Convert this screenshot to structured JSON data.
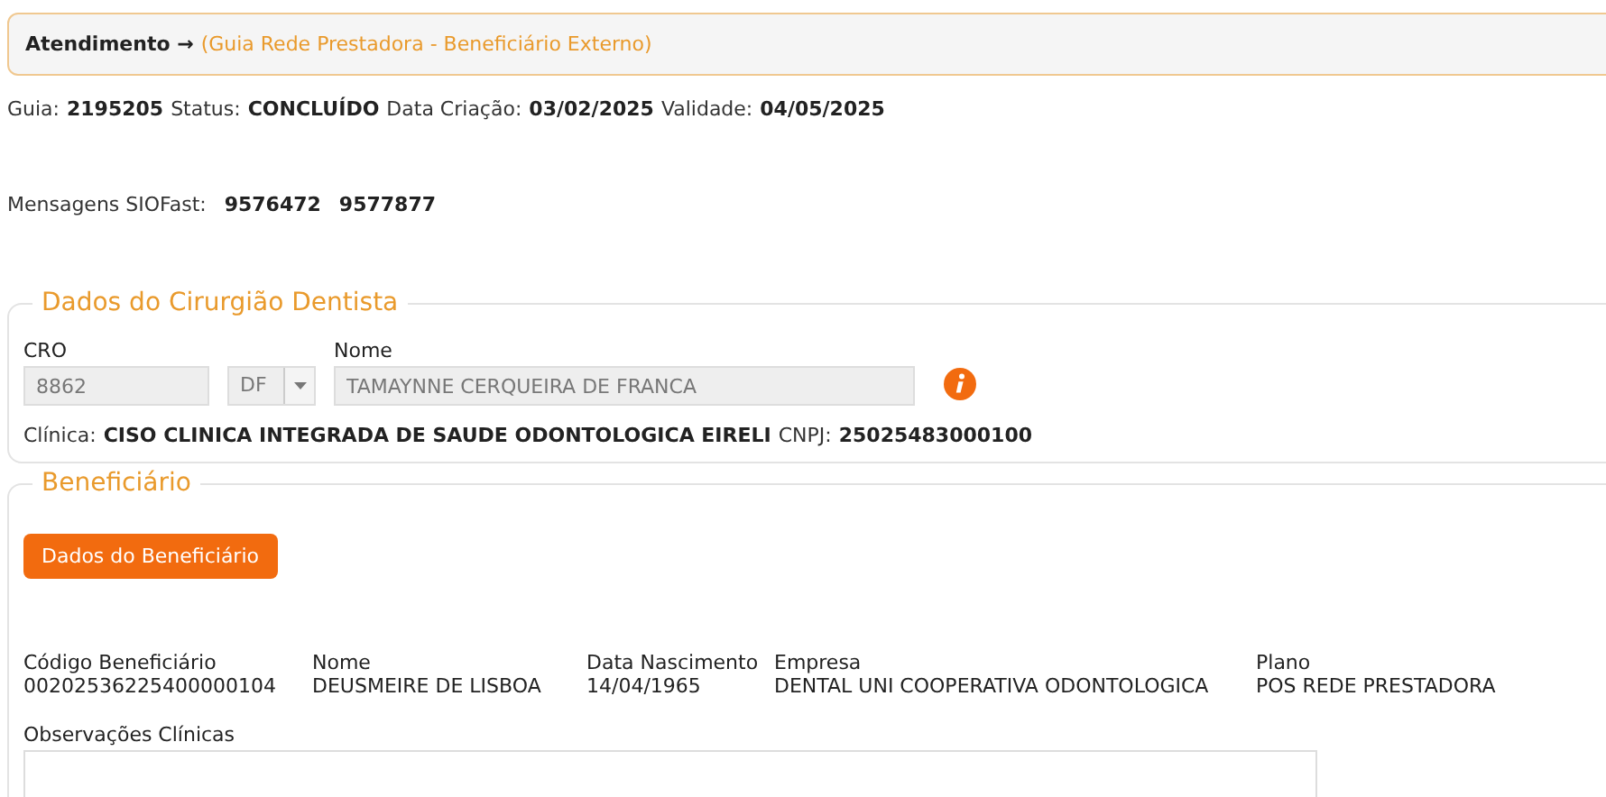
{
  "header": {
    "title": "Atendimento →",
    "subtitle": "(Guia Rede Prestadora - Beneficiário Externo)"
  },
  "guia_info": [
    {
      "label": "Guia:",
      "value": "2195205"
    },
    {
      "label": "Status:",
      "value": "CONCLUÍDO"
    },
    {
      "label": "Data Criação:",
      "value": "03/02/2025"
    },
    {
      "label": "Validade:",
      "value": "04/05/2025"
    }
  ],
  "messages": {
    "label": "Mensagens SIOFast:",
    "values": [
      "9576472",
      "9577877"
    ]
  },
  "dentist": {
    "legend": "Dados do Cirurgião Dentista",
    "cro": {
      "label": "CRO",
      "value": "8862"
    },
    "uf": {
      "value": "DF"
    },
    "name": {
      "label": "Nome",
      "value": "TAMAYNNE CERQUEIRA DE FRANCA"
    },
    "clinic": {
      "label": "Clínica:",
      "value": "CISO CLINICA INTEGRADA DE SAUDE ODONTOLOGICA EIRELI"
    },
    "cnpj": {
      "label": "CNPJ:",
      "value": "25025483000100"
    }
  },
  "beneficiary": {
    "legend": "Beneficiário",
    "button": "Dados do Beneficiário",
    "columns": [
      {
        "label": "Código Beneficiário",
        "value": "00202536225400000104"
      },
      {
        "label": "Nome",
        "value": "DEUSMEIRE DE LISBOA"
      },
      {
        "label": "Data Nascimento",
        "value": "14/04/1965"
      },
      {
        "label": "Empresa",
        "value": "DENTAL UNI COOPERATIVA ODONTOLOGICA"
      },
      {
        "label": "Plano",
        "value": "POS REDE PRESTADORA"
      }
    ],
    "observations": {
      "label": "Observações Clínicas"
    }
  }
}
